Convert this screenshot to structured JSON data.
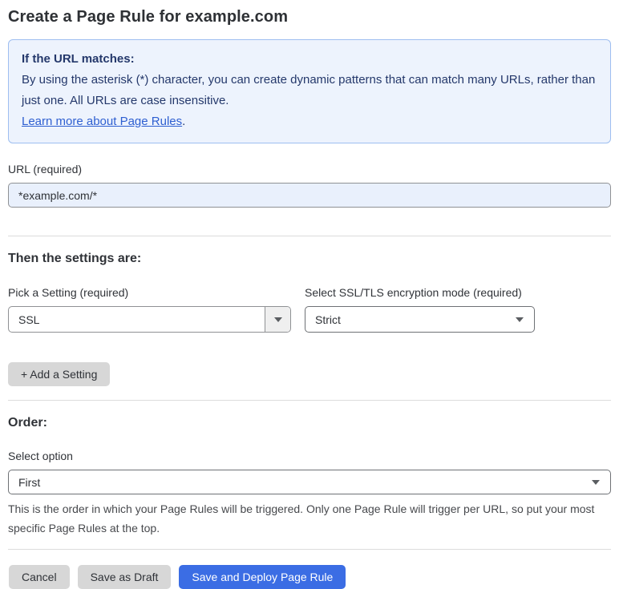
{
  "page": {
    "title": "Create a Page Rule for example.com"
  },
  "info_box": {
    "heading": "If the URL matches:",
    "body": "By using the asterisk (*) character, you can create dynamic patterns that can match many URLs, rather than just one. All URLs are case insensitive.",
    "link_label": "Learn more about Page Rules",
    "link_suffix": "."
  },
  "url_field": {
    "label": "URL (required)",
    "value": "*example.com/*"
  },
  "settings_section": {
    "heading": "Then the settings are:",
    "setting_picker": {
      "label": "Pick a Setting (required)",
      "value": "SSL"
    },
    "ssl_mode_picker": {
      "label": "Select SSL/TLS encryption mode (required)",
      "value": "Strict"
    },
    "add_setting_label": "+ Add a Setting"
  },
  "order_section": {
    "heading": "Order:",
    "select_label": "Select option",
    "value": "First",
    "help_text": "This is the order in which your Page Rules will be triggered. Only one Page Rule will trigger per URL, so put your most specific Page Rules at the top."
  },
  "footer": {
    "cancel_label": "Cancel",
    "save_draft_label": "Save as Draft",
    "save_deploy_label": "Save and Deploy Page Rule"
  },
  "colors": {
    "accent_blue": "#3b6de4",
    "info_background": "#edf3fd",
    "info_border": "#9ebef0",
    "info_text": "#24386b",
    "link_blue": "#2e5fd1",
    "url_input_background": "#e9f0fc",
    "gray_button": "#d7d7d7"
  }
}
